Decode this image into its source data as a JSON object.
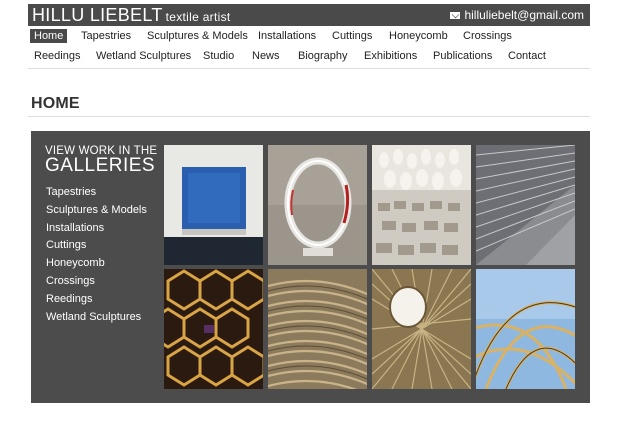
{
  "header": {
    "site_name": "HILLU LIEBELT",
    "tagline": "textile artist",
    "email": "hilluliebelt@gmail.com",
    "email_icon": "mail-icon",
    "bar_color": "#4a4a4a"
  },
  "nav": {
    "row1": [
      "Home",
      "Tapestries",
      "Sculptures & Models",
      "Installations",
      "Cuttings",
      "Honeycomb",
      "Crossings"
    ],
    "row2": [
      "Reedings",
      "Wetland Sculptures",
      "Studio",
      "News",
      "Biography",
      "Exhibitions",
      "Publications",
      "Contact"
    ],
    "active": "Home"
  },
  "page": {
    "title": "HOME"
  },
  "galleries": {
    "intro": "VIEW WORK IN THE",
    "heading": "GALLERIES",
    "links": [
      "Tapestries",
      "Sculptures & Models",
      "Installations",
      "Cuttings",
      "Honeycomb",
      "Crossings",
      "Reedings",
      "Wetland Sculptures"
    ],
    "panel_color": "#4c4c4c"
  }
}
